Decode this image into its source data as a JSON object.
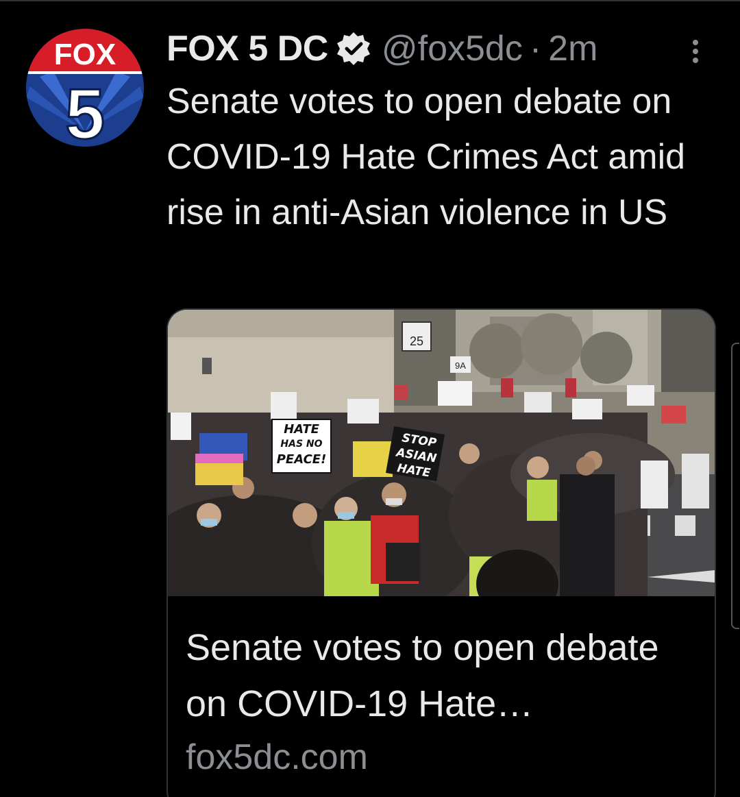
{
  "tweet": {
    "display_name": "FOX 5 DC",
    "handle": "@fox5dc",
    "separator": "·",
    "time_ago": "2m",
    "text": "Senate votes to open debate on COVID-19 Hate Crimes Act amid rise in anti-Asian violence in US",
    "avatar": {
      "logo_word": "FOX",
      "logo_number": "5"
    }
  },
  "card": {
    "title": "Senate votes to open debate on COVID-19 Hate…",
    "domain": "fox5dc.com",
    "image": {
      "sign_1": [
        "HATE",
        "HAS NO",
        "PEACE!"
      ],
      "sign_2": [
        "STOP",
        "ASIAN",
        "HATE"
      ],
      "street_sign": "25",
      "route_sign": "9A"
    }
  },
  "colors": {
    "background": "#000000",
    "primary_text": "#e7e9ea",
    "secondary_text": "#8b8f94",
    "border": "#2f3336",
    "fox_red": "#d71e28",
    "fox_blue": "#1d3d8f"
  },
  "icons": {
    "verified": "verified-badge-icon",
    "more": "more-vertical-icon"
  }
}
